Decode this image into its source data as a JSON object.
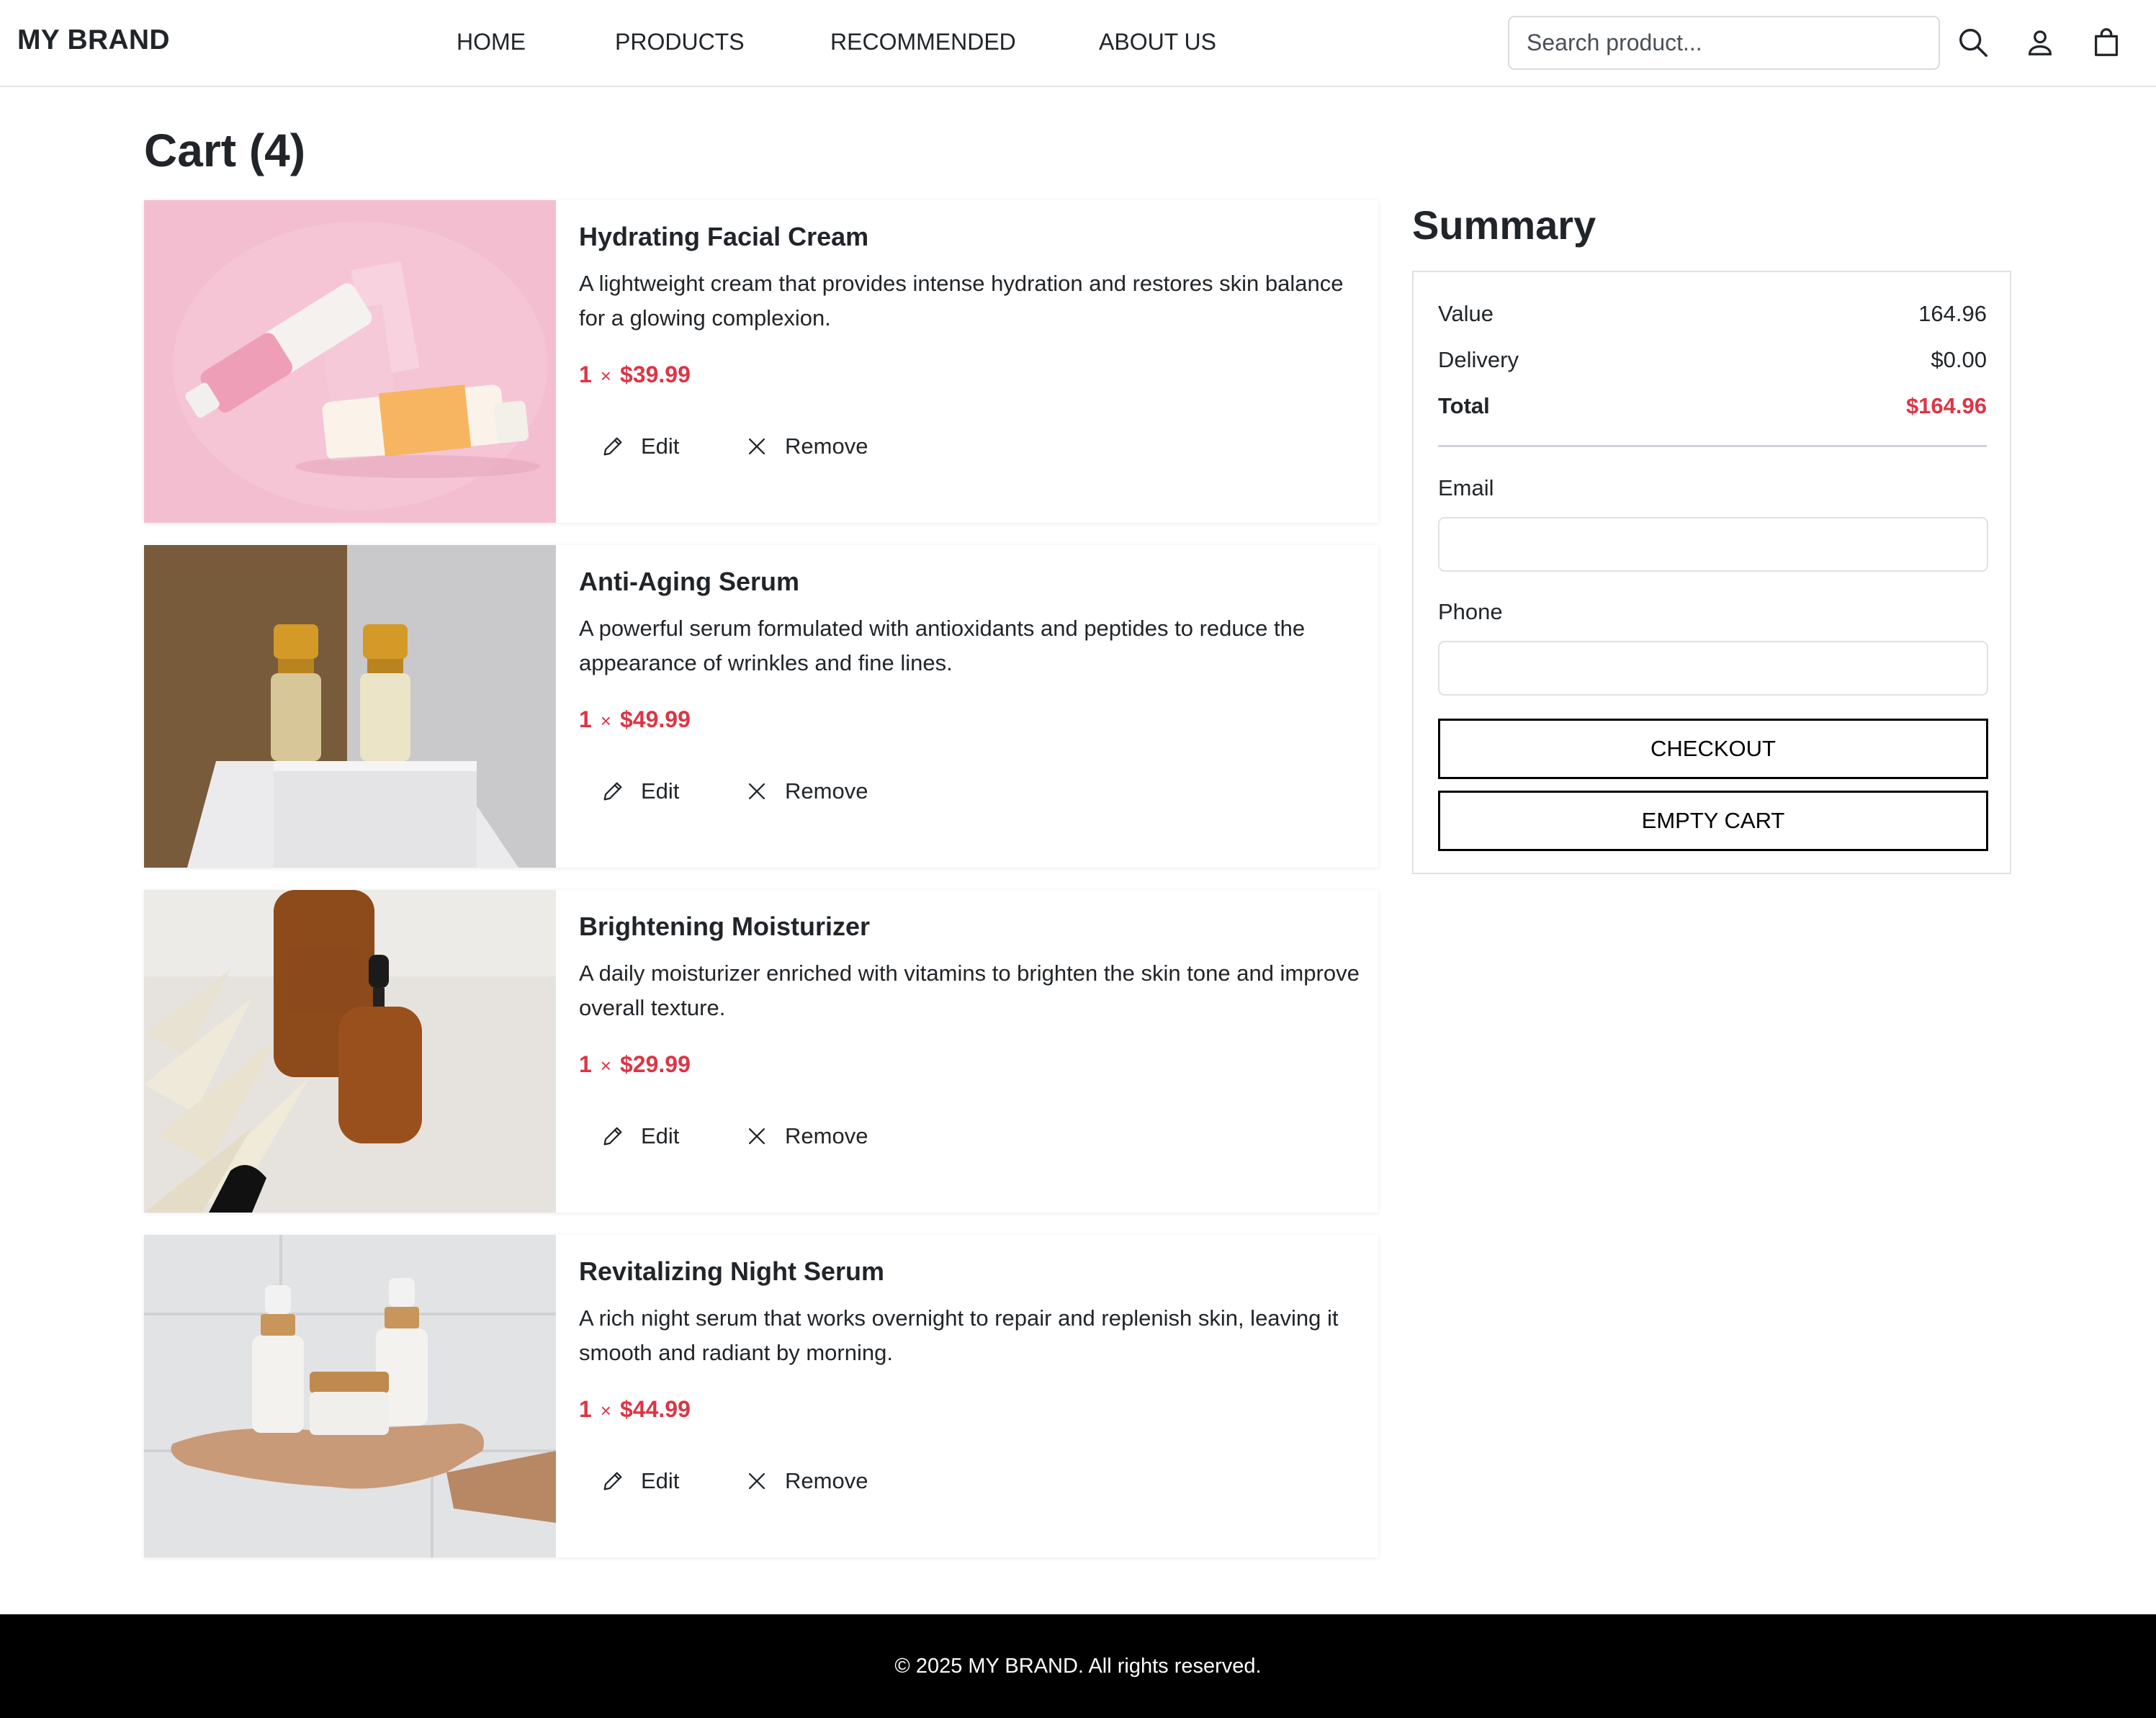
{
  "header": {
    "brand": "MY BRAND",
    "nav": [
      "HOME",
      "PRODUCTS",
      "RECOMMENDED",
      "ABOUT US"
    ],
    "search_placeholder": "Search product...",
    "icons": [
      "search-icon",
      "user-icon",
      "shopping-bag-icon"
    ]
  },
  "cart": {
    "title": "Cart (4)",
    "items": [
      {
        "name": "Hydrating Facial Cream",
        "description": "A lightweight cream that provides intense hydration and restores skin balance for a glowing complexion.",
        "quantity": "1",
        "times": "×",
        "price": "$39.99",
        "edit_label": "Edit",
        "remove_label": "Remove"
      },
      {
        "name": "Anti-Aging Serum",
        "description": "A powerful serum formulated with antioxidants and peptides to reduce the appearance of wrinkles and fine lines.",
        "quantity": "1",
        "times": "×",
        "price": "$49.99",
        "edit_label": "Edit",
        "remove_label": "Remove"
      },
      {
        "name": "Brightening Moisturizer",
        "description": "A daily moisturizer enriched with vitamins to brighten the skin tone and improve overall texture.",
        "quantity": "1",
        "times": "×",
        "price": "$29.99",
        "edit_label": "Edit",
        "remove_label": "Remove"
      },
      {
        "name": "Revitalizing Night Serum",
        "description": "A rich night serum that works overnight to repair and replenish skin, leaving it smooth and radiant by morning.",
        "quantity": "1",
        "times": "×",
        "price": "$44.99",
        "edit_label": "Edit",
        "remove_label": "Remove"
      }
    ]
  },
  "summary": {
    "title": "Summary",
    "value_label": "Value",
    "value": "164.96",
    "delivery_label": "Delivery",
    "delivery": "$0.00",
    "total_label": "Total",
    "total": "$164.96",
    "email_label": "Email",
    "email_value": "",
    "phone_label": "Phone",
    "phone_value": "",
    "checkout_label": "CHECKOUT",
    "empty_cart_label": "EMPTY CART"
  },
  "footer": {
    "copyright": "© 2025 MY BRAND. All rights reserved."
  },
  "colors": {
    "accent_price": "#dc3545",
    "text": "#212529",
    "footer_bg": "#000000"
  }
}
